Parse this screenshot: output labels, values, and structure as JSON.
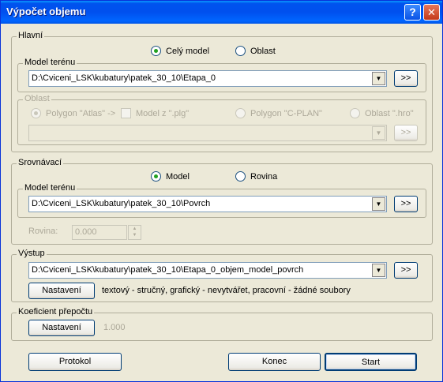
{
  "window": {
    "title": "Výpočet objemu",
    "help_label": "?",
    "close_label": "✕"
  },
  "main": {
    "legend": "Hlavní",
    "radio_whole": "Celý model",
    "radio_area": "Oblast",
    "terrain": {
      "legend": "Model terénu",
      "path": "D:\\Cviceni_LSK\\kubatury\\patek_30_10\\Etapa_0",
      "browse_label": ">>"
    },
    "area": {
      "legend": "Oblast",
      "radio_atlas": "Polygon \"Atlas\" ->",
      "check_plg": "Model z \".plg\"",
      "radio_cplan": "Polygon \"C-PLAN\"",
      "radio_hro": "Oblast \".hro\"",
      "path": "",
      "browse_label": ">>"
    }
  },
  "comparison": {
    "legend": "Srovnávací",
    "radio_model": "Model",
    "radio_plane": "Rovina",
    "terrain": {
      "legend": "Model terénu",
      "path": "D:\\Cviceni_LSK\\kubatury\\patek_30_10\\Povrch",
      "browse_label": ">>"
    },
    "plane_label": "Rovina:",
    "plane_value": "0.000",
    "spin_up": "▲",
    "spin_down": "▼"
  },
  "output": {
    "legend": "Výstup",
    "path": "D:\\Cviceni_LSK\\kubatury\\patek_30_10\\Etapa_0_objem_model_povrch",
    "browse_label": ">>",
    "settings_label": "Nastavení",
    "summary": "textový - stručný,  grafický - nevytvářet,  pracovní - žádné soubory"
  },
  "coefficient": {
    "legend": "Koeficient přepočtu",
    "settings_label": "Nastavení",
    "value": "1.000"
  },
  "footer": {
    "protocol_label": "Protokol",
    "end_label": "Konec",
    "start_label": "Start"
  },
  "icons": {
    "dropdown": "▼"
  }
}
